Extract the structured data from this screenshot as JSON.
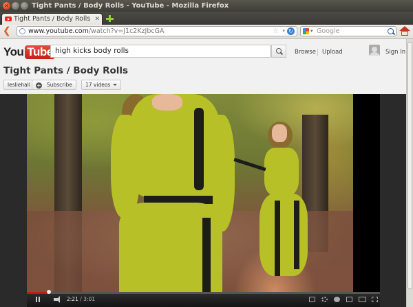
{
  "window": {
    "title": "Tight Pants / Body Rolls - YouTube - Mozilla Firefox"
  },
  "tab": {
    "label": "Tight Pants / Body Rolls - YouTube",
    "favicon": "youtube-icon"
  },
  "navbar": {
    "url_prefix": "www.youtube.com",
    "url_rest": "/watch?v=J1c2KzJbcGA",
    "search_engine": "Google",
    "search_placeholder": "Google"
  },
  "youtube": {
    "logo_you": "You",
    "logo_tube": "Tube",
    "search_value": "high kicks body rolls",
    "links": {
      "browse": "Browse",
      "upload": "Upload",
      "sign_in": "Sign In"
    },
    "video_title": "Tight Pants / Body Rolls",
    "channel": "lesliehall",
    "subscribe": "Subscribe",
    "videos_count": "17 videos"
  },
  "player": {
    "current_time": "2:21",
    "separator": " / ",
    "duration": "3:01",
    "progress": 0.062,
    "accent": "#c71616"
  }
}
